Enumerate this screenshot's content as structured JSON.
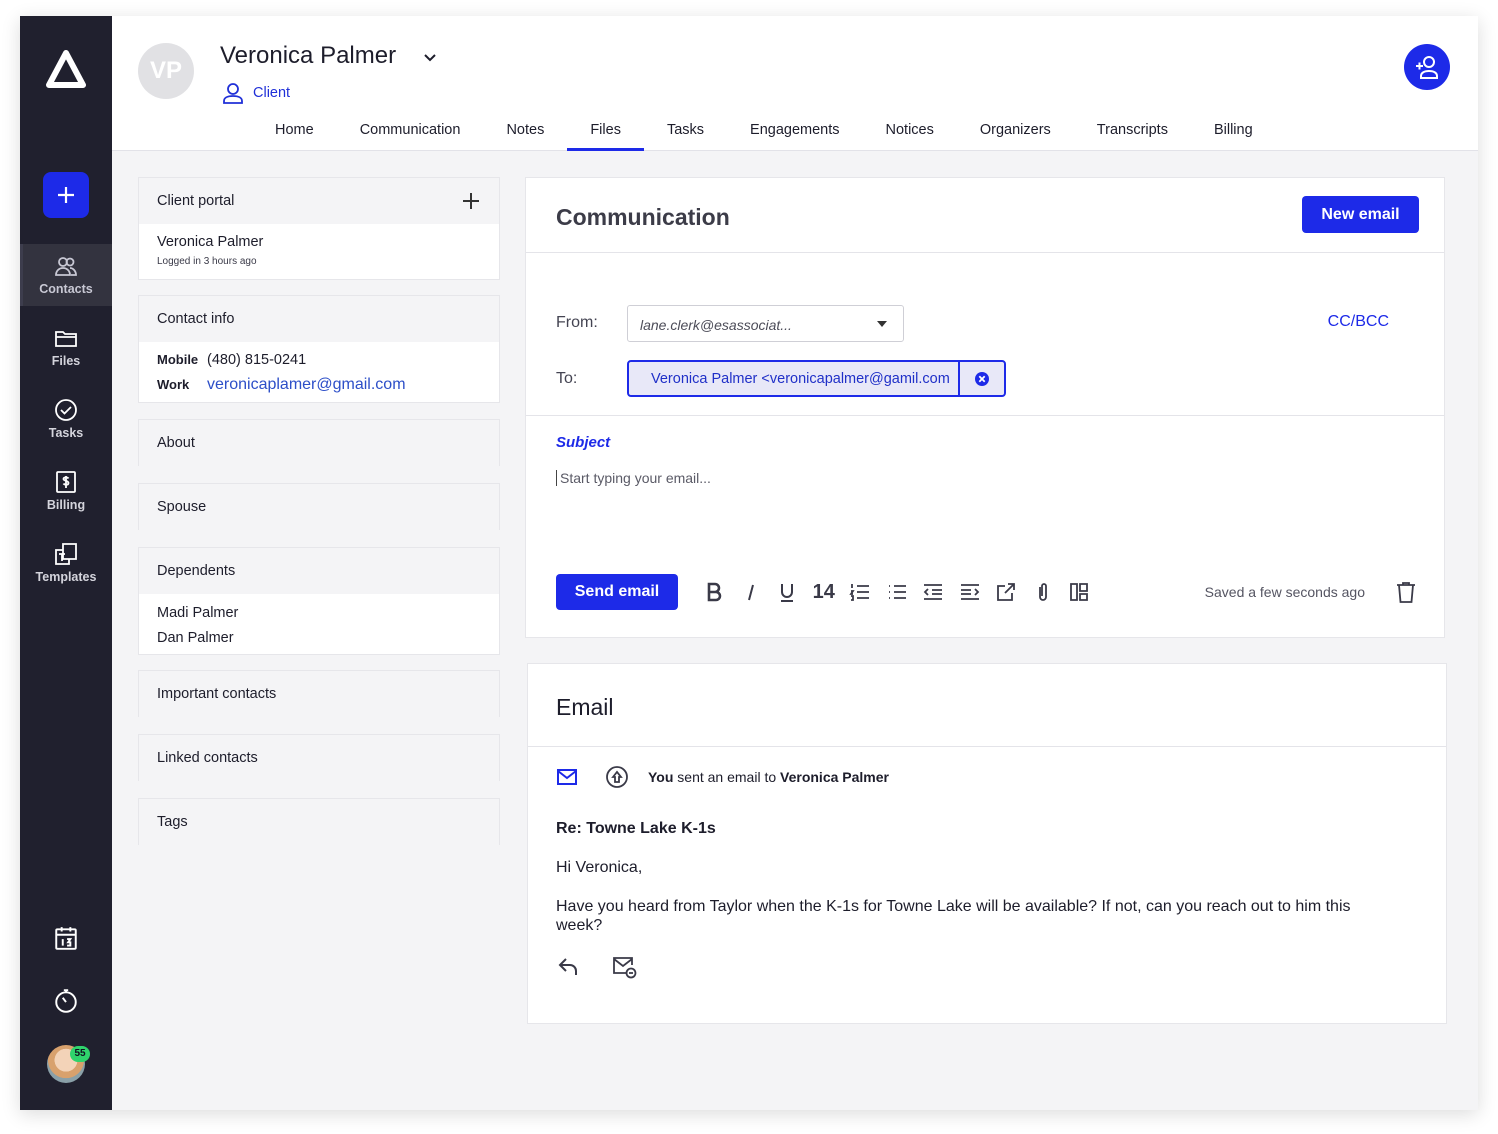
{
  "sidebar": {
    "logo_icon": "triangle-logo",
    "items": [
      {
        "label": "Contacts",
        "icon": "contacts-icon",
        "active": true
      },
      {
        "label": "Files",
        "icon": "folder-icon"
      },
      {
        "label": "Tasks",
        "icon": "check-circle-icon"
      },
      {
        "label": "Billing",
        "icon": "billing-icon"
      },
      {
        "label": "Templates",
        "icon": "templates-icon"
      }
    ],
    "badge_count": "55"
  },
  "header": {
    "initials": "VP",
    "name": "Veronica Palmer",
    "type": "Client",
    "tabs": [
      {
        "label": "Home"
      },
      {
        "label": "Communication"
      },
      {
        "label": "Notes"
      },
      {
        "label": "Files",
        "active": true
      },
      {
        "label": "Tasks"
      },
      {
        "label": "Engagements"
      },
      {
        "label": "Notices"
      },
      {
        "label": "Organizers"
      },
      {
        "label": "Transcripts"
      },
      {
        "label": "Billing"
      }
    ]
  },
  "cards": {
    "client_portal": {
      "title": "Client portal",
      "name": "Veronica Palmer",
      "status": "Logged in 3 hours ago"
    },
    "contact_info": {
      "title": "Contact info",
      "mobile_label": "Mobile",
      "mobile": "(480) 815-0241",
      "work_label": "Work",
      "work": "veronicaplamer@gmail.com"
    },
    "about": {
      "title": "About"
    },
    "spouse": {
      "title": "Spouse"
    },
    "dependents": {
      "title": "Dependents",
      "items": [
        "Madi Palmer",
        "Dan Palmer"
      ]
    },
    "important": {
      "title": "Important contacts"
    },
    "linked": {
      "title": "Linked contacts"
    },
    "tags": {
      "title": "Tags"
    }
  },
  "compose": {
    "title": "Communication",
    "new_email": "New email",
    "from_label": "From:",
    "from_value": "lane.clerk@esassociat...",
    "cc_bcc": "CC/BCC",
    "to_label": "To:",
    "to_value": "Veronica Palmer <veronicapalmer@gamil.com",
    "subject_placeholder": "Subject",
    "body_placeholder": "Start typing your email...",
    "send": "Send email",
    "font_size": "14",
    "saved": "Saved a few seconds ago"
  },
  "email": {
    "title": "Email",
    "actor": "You",
    "action": "sent an email to",
    "recipient": "Veronica Palmer",
    "subject": "Re: Towne Lake K-1s",
    "greeting": "Hi Veronica,",
    "body": "Have you heard from Taylor when the K-1s for Towne Lake will be available? If not, can you reach out to him this week?"
  },
  "colors": {
    "accent": "#1d2ae8",
    "sidebar": "#20202e",
    "badge": "#2fd36c"
  }
}
